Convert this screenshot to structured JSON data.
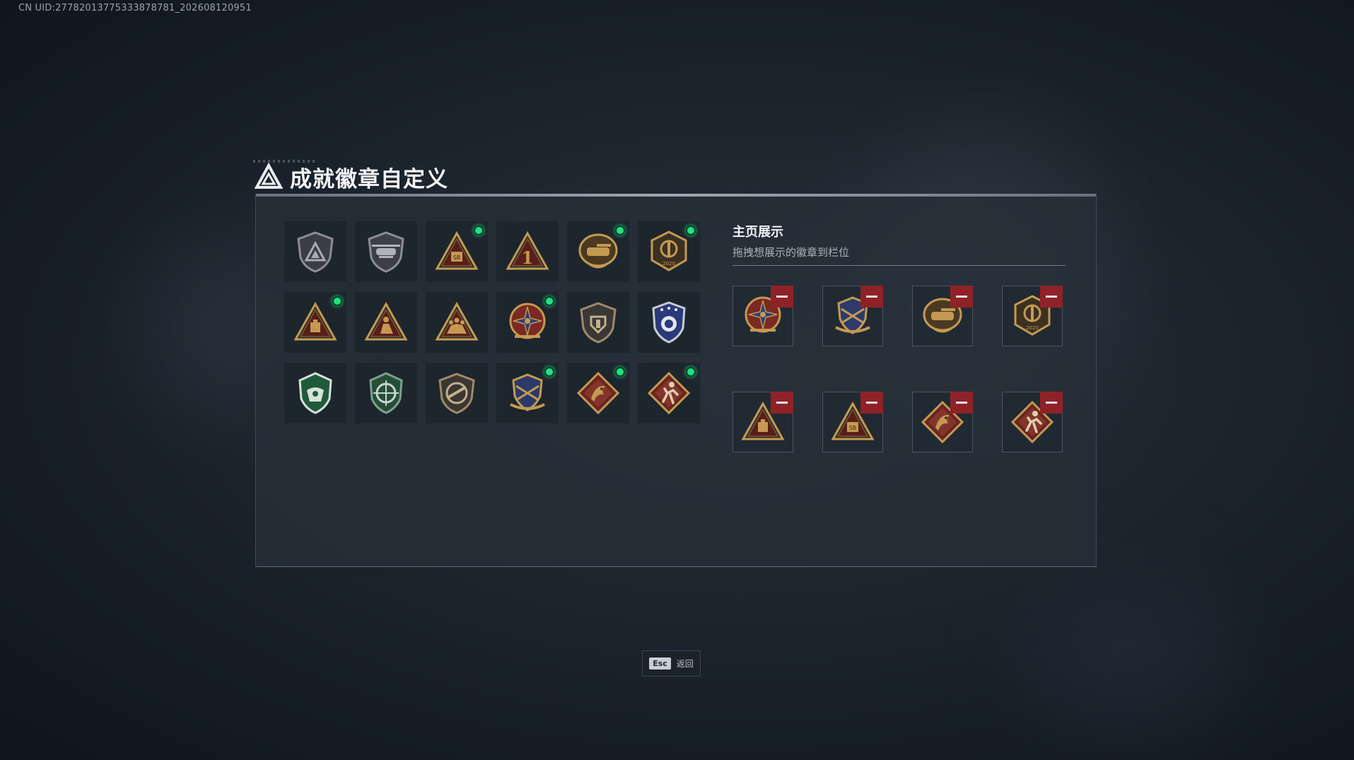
{
  "uid_text": "CN UID:27782013775333878781_202608120951",
  "header": {
    "title": "成就徽章自定义",
    "icon": "triangle-logo-icon"
  },
  "colors": {
    "gold": "#c49a52",
    "new_dot": "#1ee383",
    "remove": "#8f2228"
  },
  "badges": [
    {
      "icon": "shield-triangle-badge",
      "new": false
    },
    {
      "icon": "helicopter-shield-badge",
      "new": false
    },
    {
      "icon": "triangle-sb-badge",
      "new": true
    },
    {
      "icon": "triangle-number-one-badge",
      "new": false
    },
    {
      "icon": "tank-emblem-badge",
      "new": true
    },
    {
      "icon": "delta-force-2020-badge",
      "new": true
    },
    {
      "icon": "triangle-box-badge",
      "new": true
    },
    {
      "icon": "triangle-soldier-badge",
      "new": false
    },
    {
      "icon": "triangle-squad-badge",
      "new": false
    },
    {
      "icon": "star-compass-badge",
      "new": true
    },
    {
      "icon": "fist-shield-badge",
      "new": false
    },
    {
      "icon": "blue-police-badge",
      "new": false
    },
    {
      "icon": "green-eagle-shield-badge",
      "new": false
    },
    {
      "icon": "green-crosshair-shield-badge",
      "new": false
    },
    {
      "icon": "rifle-shield-badge",
      "new": false
    },
    {
      "icon": "winged-rifles-badge",
      "new": true
    },
    {
      "icon": "dragon-diamond-badge",
      "new": true
    },
    {
      "icon": "runner-diamond-badge",
      "new": true
    }
  ],
  "showcase": {
    "title": "主页展示",
    "subtitle": "拖拽想展示的徽章到栏位",
    "slots": [
      {
        "icon": "star-compass-badge"
      },
      {
        "icon": "winged-rifles-badge"
      },
      {
        "icon": "tank-emblem-badge"
      },
      {
        "icon": "delta-force-2020-badge"
      },
      {
        "icon": "triangle-box-badge"
      },
      {
        "icon": "triangle-sb-badge"
      },
      {
        "icon": "dragon-diamond-badge"
      },
      {
        "icon": "runner-diamond-badge"
      }
    ]
  },
  "footer": {
    "esc_key": "Esc",
    "back_label": "返回"
  }
}
